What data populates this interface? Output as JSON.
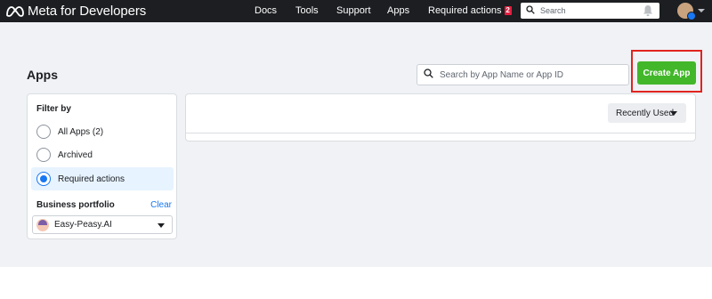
{
  "topbar": {
    "logo_text": "Meta for Developers",
    "nav": [
      {
        "label": "Docs"
      },
      {
        "label": "Tools"
      },
      {
        "label": "Support"
      },
      {
        "label": "Apps"
      },
      {
        "label": "Required actions",
        "badge": "2"
      }
    ],
    "search_placeholder": "Search",
    "icons": [
      "meta-logo-icon",
      "search-icon",
      "bell-icon",
      "avatar",
      "chevron-down-icon"
    ]
  },
  "page": {
    "title": "Apps",
    "search_placeholder": "Search by App Name or App ID",
    "create_button": "Create App"
  },
  "filter": {
    "title": "Filter by",
    "options": [
      {
        "label": "All Apps (2)",
        "selected": false
      },
      {
        "label": "Archived",
        "selected": false
      },
      {
        "label": "Required actions",
        "selected": true
      }
    ],
    "business_portfolio_title": "Business portfolio",
    "clear_label": "Clear",
    "selected_portfolio": "Easy-Peasy.AI"
  },
  "results": {
    "sort_label": "Recently Used"
  },
  "colors": {
    "topbar_bg": "#1c1e21",
    "page_bg": "#f0f2f5",
    "primary_green": "#42b72a",
    "accent_blue": "#1877f2",
    "highlight_red": "#e0241f",
    "badge_red": "#e41e3f"
  }
}
